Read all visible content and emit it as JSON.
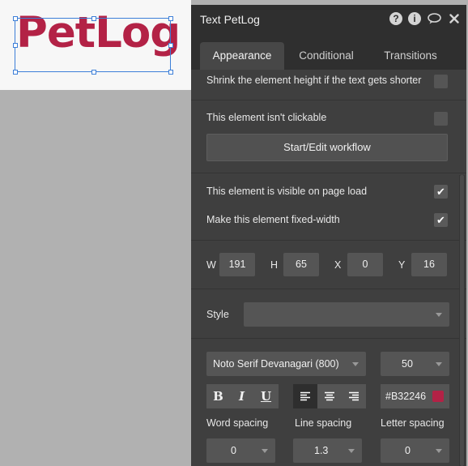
{
  "canvas": {
    "logo_text": "PetLog",
    "logo_color": "#B32246"
  },
  "panel": {
    "title": "Text PetLog",
    "header_icons": [
      "help-icon",
      "info-icon",
      "comment-icon",
      "close-icon"
    ],
    "tabs": [
      {
        "label": "Appearance",
        "active": true
      },
      {
        "label": "Conditional",
        "active": false
      },
      {
        "label": "Transitions",
        "active": false
      }
    ],
    "options": {
      "shrink_label": "Shrink the element height if the text gets shorter",
      "shrink_checked": false,
      "not_clickable_label": "This element isn't clickable",
      "not_clickable_checked": false,
      "workflow_button": "Start/Edit workflow",
      "visible_label": "This element is visible on page load",
      "visible_checked": true,
      "fixed_width_label": "Make this element fixed-width",
      "fixed_width_checked": true
    },
    "dimensions": {
      "w_label": "W",
      "w_value": "191",
      "h_label": "H",
      "h_value": "65",
      "x_label": "X",
      "x_value": "0",
      "y_label": "Y",
      "y_value": "16"
    },
    "style": {
      "label": "Style",
      "value": ""
    },
    "font": {
      "family": "Noto Serif Devanagari (800)",
      "size": "50",
      "bold_label": "B",
      "italic_label": "I",
      "underline_label": "U",
      "alignment": "left",
      "color_hex": "#B32246",
      "color_swatch": "#B32246"
    },
    "spacing": {
      "word_label": "Word spacing",
      "word_value": "0",
      "line_label": "Line spacing",
      "line_value": "1.3",
      "letter_label": "Letter spacing",
      "letter_value": "0"
    }
  }
}
